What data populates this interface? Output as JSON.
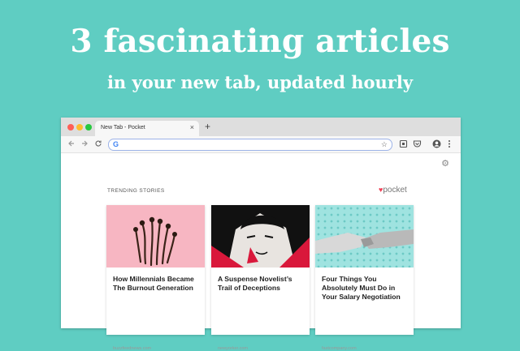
{
  "promo": {
    "headline": "3 fascinating articles",
    "subhead": "in your new tab, updated hourly"
  },
  "browser": {
    "tab_title": "New Tab - Pocket",
    "tab_close": "×",
    "new_tab": "+",
    "omnibox_value": "",
    "google_logo": "G"
  },
  "newtab": {
    "section_label": "TRENDING STORIES",
    "brand": "pocket",
    "cards": [
      {
        "title": "How Millennials Became The Burnout Generation",
        "source": "buzzfeednews.com"
      },
      {
        "title": "A Suspense Novelist’s Trail of Deceptions",
        "source": "newyorker.com"
      },
      {
        "title": "Four Things You Absolutely Must Do in Your Salary Negotiation",
        "source": "fastcompany.com"
      }
    ]
  },
  "colors": {
    "background": "#5fcdc2",
    "pocket_red": "#ef4056",
    "card1_image_bg": "#f7b6c2",
    "card2_image_bg": "#d9183b",
    "card3_image_bg": "#9fe3e0"
  },
  "icons": [
    "back-icon",
    "forward-icon",
    "reload-icon",
    "star-icon",
    "pocket-save-icon",
    "extension-icon",
    "profile-icon",
    "menu-icon",
    "gear-icon"
  ]
}
